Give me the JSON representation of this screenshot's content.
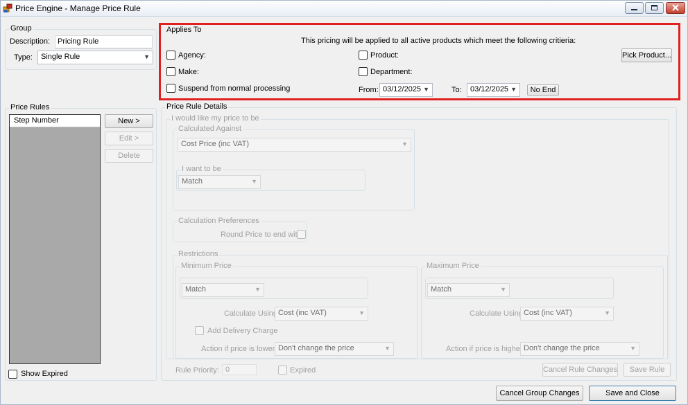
{
  "window": {
    "title": "Price Engine - Manage Price Rule"
  },
  "group": {
    "title": "Group",
    "description_label": "Description:",
    "description_value": "Pricing Rule",
    "type_label": "Type:",
    "type_value": "Single Rule"
  },
  "applies_to": {
    "title": "Applies To",
    "info": "This pricing will be applied to all active products which meet the following critieria:",
    "agency_label": "Agency:",
    "make_label": "Make:",
    "suspend_label": "Suspend from normal processing",
    "product_label": "Product:",
    "department_label": "Department:",
    "pick_product_label": "Pick Product...",
    "from_label": "From:",
    "from_value": "03/12/2025",
    "to_label": "To:",
    "to_value": "03/12/2025",
    "no_end_label": "No End"
  },
  "price_rules": {
    "title": "Price Rules",
    "column_header": "Step Number",
    "new_label": "New >",
    "edit_label": "Edit >",
    "delete_label": "Delete",
    "show_expired_label": "Show Expired"
  },
  "details": {
    "title": "Price Rule Details",
    "i_would_like": "I would like my price to be",
    "calculated_against_title": "Calculated Against",
    "calculated_against_value": "Cost Price (inc VAT)",
    "i_want_to_be_title": "I want to be",
    "i_want_to_be_value": "Match",
    "calc_prefs_title": "Calculation Preferences",
    "round_price_label": "Round Price to end with",
    "restrictions_title": "Restrictions",
    "min_price_title": "Minimum Price",
    "min_match_value": "Match",
    "min_calc_using_label": "Calculate Using:",
    "min_calc_using_value": "Cost (inc VAT)",
    "add_delivery_label": "Add Delivery Charge",
    "min_action_label": "Action if price is lower:",
    "min_action_value": "Don't change the price",
    "max_price_title": "Maximum Price",
    "max_match_value": "Match",
    "max_calc_using_label": "Calculate Using:",
    "max_calc_using_value": "Cost (inc VAT)",
    "max_action_label": "Action if price is higher:",
    "max_action_value": "Don't change the price",
    "rule_priority_label": "Rule Priority:",
    "rule_priority_value": "0",
    "expired_label": "Expired",
    "cancel_rule_label": "Cancel Rule Changes",
    "save_rule_label": "Save Rule"
  },
  "footer": {
    "cancel_group_label": "Cancel Group Changes",
    "save_close_label": "Save and Close"
  },
  "colors": {
    "highlight": "#e02020",
    "window_bg": "#f0f0f0"
  }
}
